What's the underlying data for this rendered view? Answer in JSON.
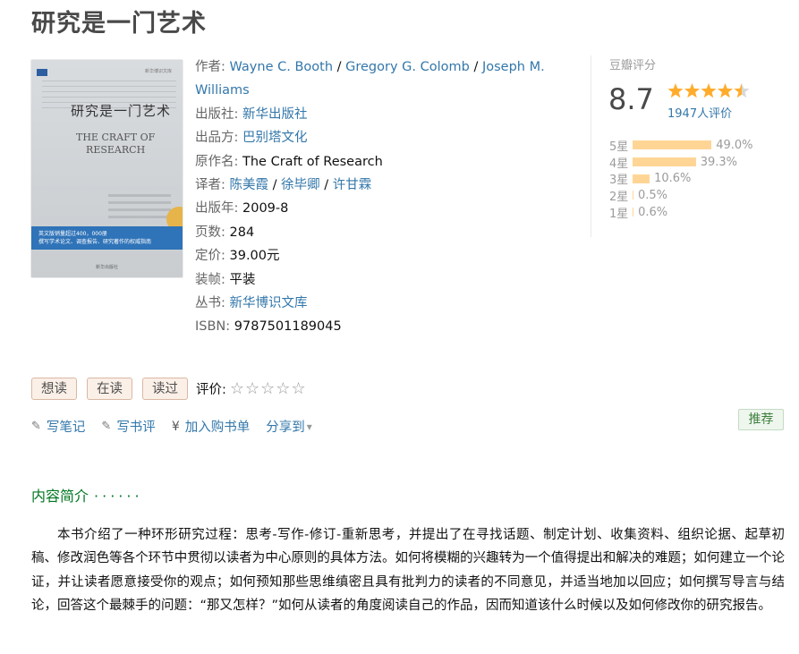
{
  "title": "研究是一门艺术",
  "cover": {
    "series": "新华博识文库",
    "cn_title": "研究是一门艺术",
    "en_title_line1": "THE CRAFT OF",
    "en_title_line2": "RESEARCH",
    "band_line1": "英文版销量超过400，000册",
    "band_line2": "撰写学术论文、调查报告、研究著作的权威指南",
    "publisher": "新华出版社"
  },
  "info": {
    "author_label": "作者:",
    "authors": [
      "Wayne C. Booth",
      "Gregory G. Colomb",
      "Joseph M. Williams"
    ],
    "publisher_label": "出版社:",
    "publisher": "新华出版社",
    "producer_label": "出品方:",
    "producer": "巴别塔文化",
    "original_title_label": "原作名:",
    "original_title": "The Craft of Research",
    "translator_label": "译者:",
    "translators": [
      "陈美霞",
      "徐毕卿",
      "许甘霖"
    ],
    "pubdate_label": "出版年:",
    "pubdate": "2009-8",
    "pages_label": "页数:",
    "pages": "284",
    "price_label": "定价:",
    "price": "39.00元",
    "binding_label": "装帧:",
    "binding": "平装",
    "series_label": "丛书:",
    "series": "新华博识文库",
    "isbn_label": "ISBN:",
    "isbn": "9787501189045",
    "separator": "/"
  },
  "rating": {
    "label": "豆瓣评分",
    "score": "8.7",
    "stars_value": 4.5,
    "count_text": "1947人评价",
    "distribution": [
      {
        "label": "5星",
        "percent": 49.0,
        "text": "49.0%"
      },
      {
        "label": "4星",
        "percent": 39.3,
        "text": "39.3%"
      },
      {
        "label": "3星",
        "percent": 10.6,
        "text": "10.6%"
      },
      {
        "label": "2星",
        "percent": 0.5,
        "text": "0.5%"
      },
      {
        "label": "1星",
        "percent": 0.6,
        "text": "0.6%"
      }
    ]
  },
  "actions": {
    "want": "想读",
    "reading": "在读",
    "read": "读过",
    "rate_label": "评价:",
    "user_stars": "☆☆☆☆☆"
  },
  "links": {
    "write_note": "写笔记",
    "write_review": "写书评",
    "add_cart": "加入购书单",
    "share": "分享到",
    "share_arrow": "▾",
    "pencil_icon": "✎",
    "yen_icon": "¥"
  },
  "recommend": "推荐",
  "intro": {
    "heading": "内容简介",
    "dots": "······",
    "text": "本书介绍了一种环形研究过程：思考-写作-修订-重新思考，并提出了在寻找话题、制定计划、收集资料、组织论据、起草初稿、修改润色等各个环节中贯彻以读者为中心原则的具体方法。如何将模糊的兴趣转为一个值得提出和解决的难题；如何建立一个论证，并让读者愿意接受你的观点；如何预知那些思维缜密且具有批判力的读者的不同意见，并适当地加以回应；如何撰写导言与结论，回答这个最棘手的问题：“那又怎样？”如何从读者的角度阅读自己的作品，因而知道该什么时候以及如何修改你的研究报告。"
  },
  "colors": {
    "link": "#3377aa",
    "star": "#ffac2d",
    "bar": "#ffd596",
    "intro_heading": "#007722"
  }
}
